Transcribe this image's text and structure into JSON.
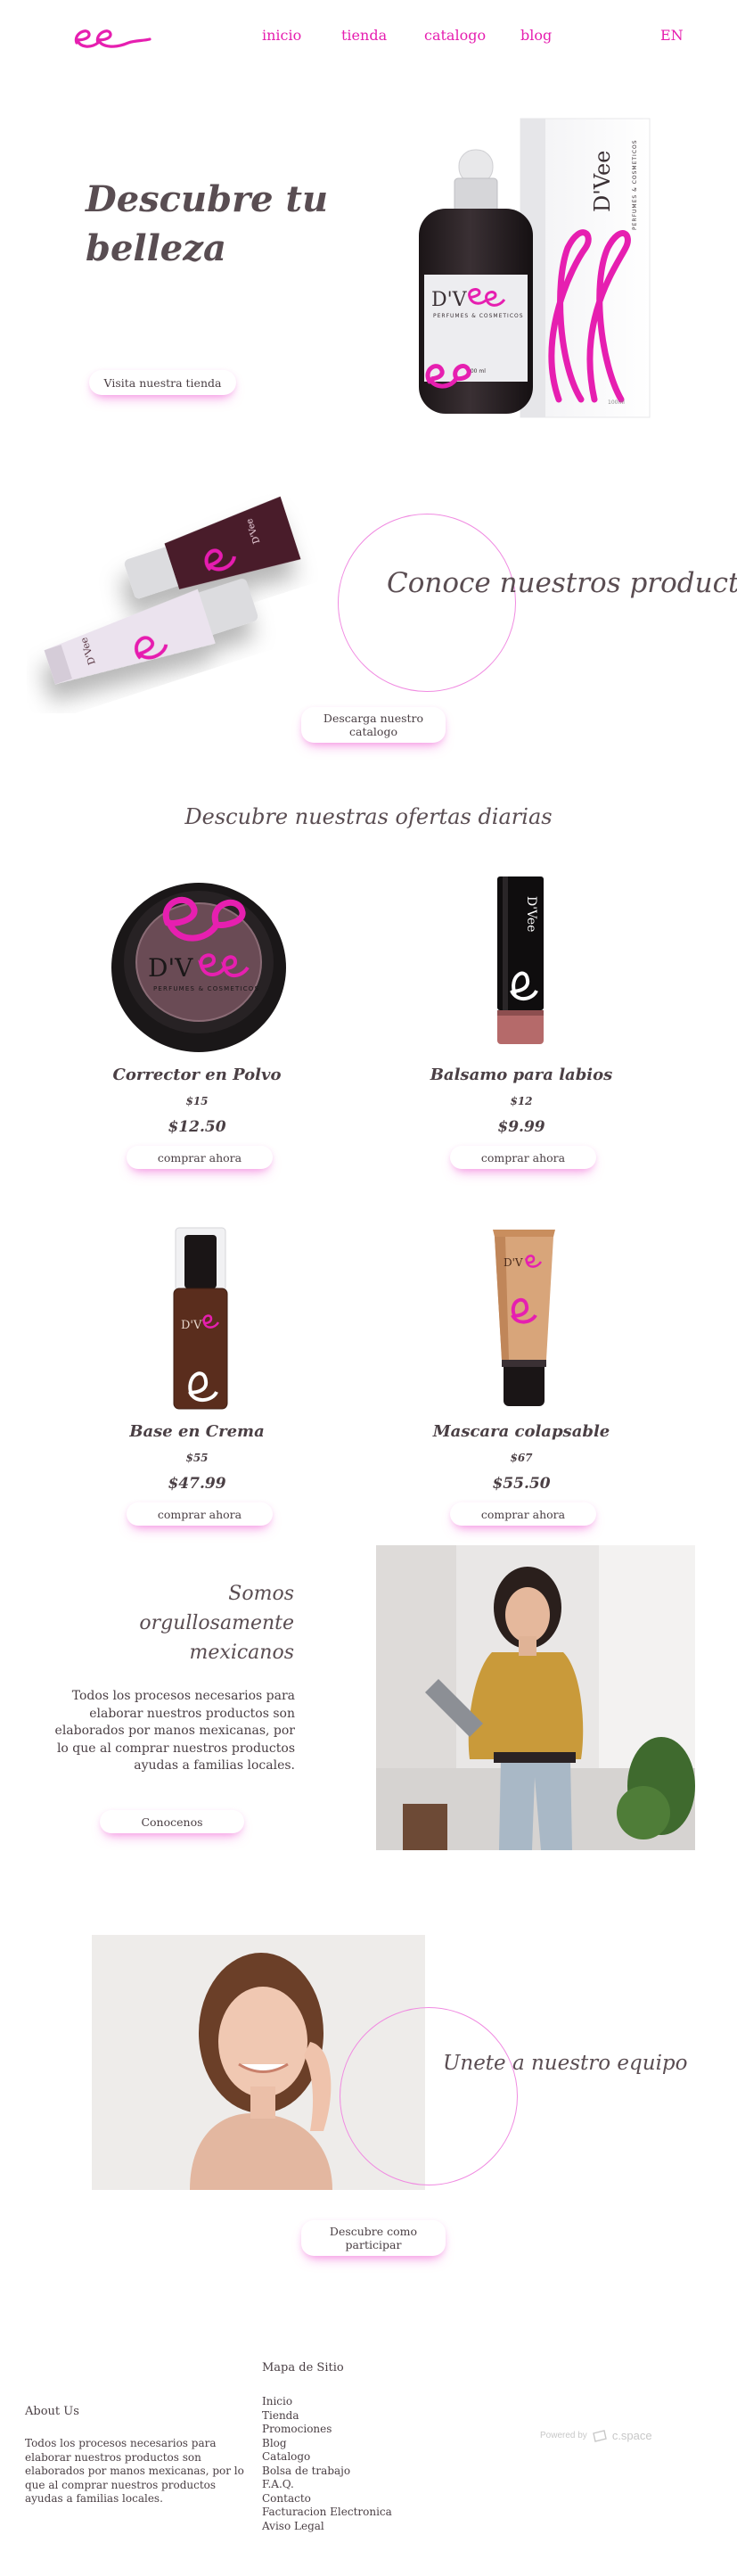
{
  "nav": {
    "logo_text": "ee",
    "links": [
      "inicio",
      "tienda",
      "catalogo",
      "blog"
    ],
    "lang": "EN"
  },
  "hero": {
    "title": "Descubre tu belleza",
    "button": "Visita nuestra tienda",
    "bottle_brand": "D'Vee",
    "bottle_sub": "PERFUMES & COSMETICOS",
    "bottle_volume": "100 ml",
    "box_volume": "100ml"
  },
  "products_intro": {
    "title": "Conoce nuestros productos",
    "button": "Descarga nuestro catalogo",
    "tube_brand": "D'Vee"
  },
  "offers": {
    "title": "Descubre nuestras ofertas diarias",
    "buy_label": "comprar ahora",
    "items": [
      {
        "name": "Corrector en Polvo",
        "old_price": "$15",
        "price": "$12.50",
        "brand": "D'Vee"
      },
      {
        "name": "Balsamo para labios",
        "old_price": "$12",
        "price": "$9.99",
        "brand": "D'Vee"
      },
      {
        "name": "Base en Crema",
        "old_price": "$55",
        "price": "$47.99",
        "brand": "D'Vee"
      },
      {
        "name": "Mascara colapsable",
        "old_price": "$67",
        "price": "$55.50",
        "brand": "D'Vee"
      }
    ]
  },
  "proud": {
    "title": "Somos orgullosamente mexicanos",
    "body": "Todos los procesos necesarios para elaborar nuestros productos son elaborados por manos mexicanas, por lo que al comprar nuestros productos ayudas a familias locales.",
    "button": "Conocenos"
  },
  "team": {
    "title": "Unete a nuestro equipo",
    "button": "Descubre como participar"
  },
  "footer": {
    "about_title": "About Us",
    "about_body": "Todos los procesos necesarios para elaborar nuestros productos son elaborados por manos mexicanas, por lo que al comprar nuestros productos ayudas a familias locales.",
    "sitemap_title": "Mapa de Sitio",
    "sitemap_links": [
      "Inicio",
      "Tienda",
      "Promociones",
      "Blog",
      "Catalogo",
      "Bolsa de trabajo",
      "F.A.Q.",
      "Contacto",
      "Facturacion Electronica",
      "Aviso Legal"
    ],
    "powered_by": "Powered by",
    "powered_brand": "c.space"
  },
  "colors": {
    "accent": "#e61fb0",
    "text": "#4a3f44",
    "circle": "#f08ae1"
  }
}
